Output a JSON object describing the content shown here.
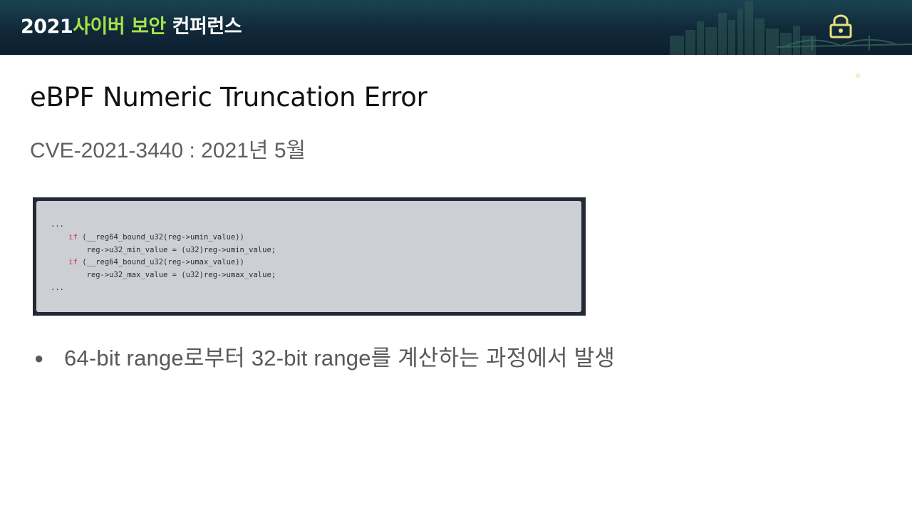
{
  "header": {
    "year": "2021",
    "accent": "사이버 보안",
    "rest": "컨퍼런스",
    "bg_color": "#102838",
    "accent_color": "#a6e14a",
    "lock_icon": "padlock-icon"
  },
  "slide": {
    "title": "eBPF Numeric Truncation Error",
    "subtitle": "CVE-2021-3440 : 2021년 5월"
  },
  "code": {
    "lines": [
      {
        "kw": "",
        "text": "..."
      },
      {
        "kw": "if",
        "text": " (__reg64_bound_u32(reg->umin_value))"
      },
      {
        "kw": "",
        "text": "reg->u32_min_value = (u32)reg->umin_value;"
      },
      {
        "kw": "if",
        "text": " (__reg64_bound_u32(reg->umax_value))"
      },
      {
        "kw": "",
        "text": "reg->u32_max_value = (u32)reg->umax_value;"
      },
      {
        "kw": "",
        "text": "..."
      }
    ]
  },
  "bullets": [
    {
      "symbol": "●",
      "text": "64-bit range로부터 32-bit range를 계산하는 과정에서 발생"
    }
  ]
}
